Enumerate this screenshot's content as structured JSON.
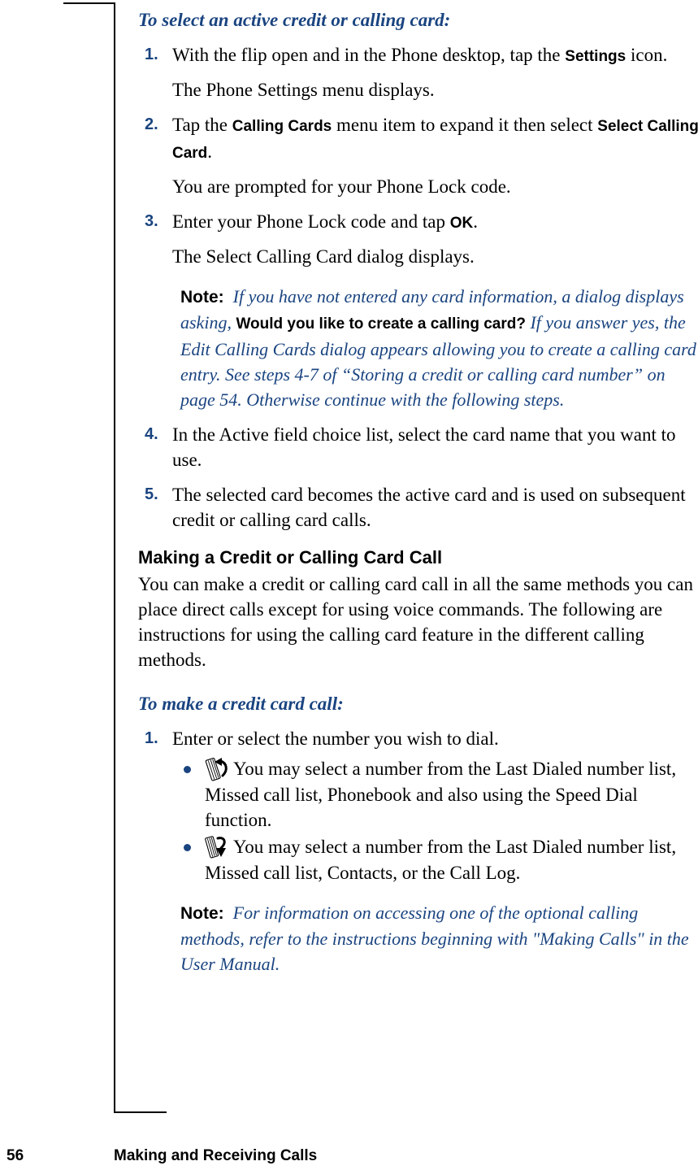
{
  "page": {
    "number": "56",
    "chapter": "Making and Receiving Calls"
  },
  "procedure_1": {
    "heading": "To select an active credit or calling card:",
    "steps": [
      {
        "num": "1.",
        "text_before": "With the flip open and in the Phone desktop, tap the ",
        "ui_term": "Settings",
        "text_after": " icon.",
        "result": "The Phone Settings menu displays."
      },
      {
        "num": "2.",
        "text_before": "Tap the ",
        "ui_term": "Calling Cards",
        "text_mid": " menu item to expand it then select ",
        "ui_term_2": "Select Calling Card",
        "text_after": ".",
        "result": "You are prompted for your Phone Lock code."
      },
      {
        "num": "3.",
        "text_before": "Enter your Phone Lock code and tap ",
        "ui_term": "OK",
        "text_after": ".",
        "result": "The Select Calling Card dialog displays."
      },
      {
        "num": "4.",
        "text_before": "In the Active field choice list, select the card name that you want to use.",
        "result": ""
      },
      {
        "num": "5.",
        "text_before": "The selected card becomes the active card and is used on subsequent credit or calling card calls.",
        "result": ""
      }
    ],
    "note": {
      "label": "Note:",
      "part_1": "If you have not entered any card information, a dialog displays asking,",
      "dialog_text": "Would you like to create a calling card?",
      "part_2": "If you answer yes, the Edit Calling Cards dialog appears allowing you to create a calling card entry. See steps 4-7 of “Storing a credit or calling card number” on page 54. Otherwise continue with the following steps."
    }
  },
  "section": {
    "heading": "Making a Credit or Calling Card Call",
    "paragraph": "You can make a credit or calling card call in all the same methods you can place direct calls except for using voice commands. The following are instructions for using the calling card feature in the different calling methods."
  },
  "procedure_2": {
    "heading": "To make a credit card call:",
    "step_1": {
      "num": "1.",
      "text": "Enter or select the number you wish to dial."
    },
    "bullets": [
      {
        "icon": "flip-open-phone-icon",
        "text": "You may select a number from the Last Dialed number list, Missed call list, Phonebook and also using the Speed Dial function."
      },
      {
        "icon": "flip-closed-phone-icon",
        "text": "You may select a number from the Last Dialed number list, Missed call list, Contacts, or the Call Log."
      }
    ],
    "note": {
      "label": "Note:",
      "text": "For information on accessing one of the optional calling methods, refer to the instructions beginning with \"Making Calls\" in the User Manual."
    }
  },
  "colors": {
    "accent_blue": "#1a4480",
    "text_black": "#000000"
  }
}
